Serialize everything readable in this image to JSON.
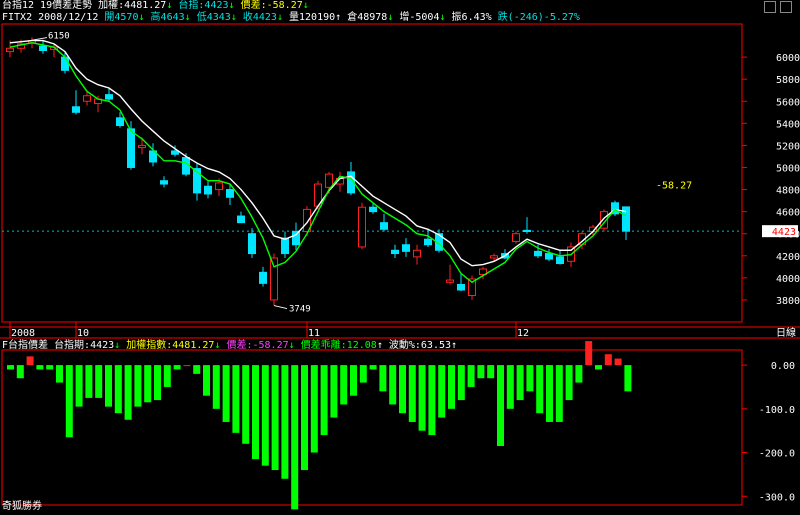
{
  "header": {
    "title": "台指12 19價差走勢",
    "index_label": "加權:",
    "index_value": "4481.27",
    "futures_label": "台指:",
    "futures_value": "4423",
    "spread_label": "價差:",
    "spread_value": "-58.27",
    "symbol": "FITX2",
    "date": "2008/12/12",
    "open": "開4570",
    "high": "高4643",
    "low": "低4343",
    "close": "收4423",
    "volume": "量120190",
    "oi": "倉48978",
    "oi_change": "增-5004",
    "amplitude": "振6.43%",
    "change": "跌(-246)-5.27%"
  },
  "lower_header": {
    "name": "F台指價差",
    "futures": "台指期:4423",
    "index": "加權指數:4481.27",
    "spread": "價差:-58.27",
    "spread_ratio": "價差乖離:12.08",
    "volatility": "波動%:63.53"
  },
  "footer": "奇狐勝券",
  "colors": {
    "up": "#ff2020",
    "down": "#00e5ff",
    "ma_white": "#ffffff",
    "ma_green": "#00ff00",
    "bar_pos": "#ff2020",
    "bar_neg": "#00ff00",
    "axis": "#ff0000"
  },
  "chart_data": [
    {
      "type": "candlestick",
      "ylim": [
        3600,
        6300
      ],
      "yticks": [
        3800,
        4000,
        4200,
        4400,
        4600,
        4800,
        5000,
        5200,
        5400,
        5600,
        5800,
        6000
      ],
      "x_labels": [
        {
          "i": 0,
          "text": "2008"
        },
        {
          "i": 6,
          "text": "10"
        },
        {
          "i": 27,
          "text": "11"
        },
        {
          "i": 46,
          "text": "12"
        }
      ],
      "last_price_tag": "4423",
      "spread_annotation": "-58.27",
      "high_annotation": "6150",
      "low_annotation": "3749",
      "x_axis_end_label": "日線",
      "candles": [
        [
          6050,
          6150,
          6000,
          6080
        ],
        [
          6080,
          6160,
          6040,
          6120
        ],
        [
          6130,
          6180,
          6080,
          6150
        ],
        [
          6100,
          6150,
          6030,
          6060
        ],
        [
          6070,
          6120,
          6000,
          6090
        ],
        [
          6000,
          6050,
          5850,
          5880
        ],
        [
          5550,
          5700,
          5480,
          5500
        ],
        [
          5600,
          5700,
          5560,
          5650
        ],
        [
          5580,
          5650,
          5500,
          5620
        ],
        [
          5660,
          5720,
          5600,
          5620
        ],
        [
          5450,
          5500,
          5360,
          5380
        ],
        [
          5350,
          5420,
          4980,
          5000
        ],
        [
          5180,
          5270,
          5120,
          5200
        ],
        [
          5150,
          5220,
          5010,
          5050
        ],
        [
          4880,
          4920,
          4820,
          4850
        ],
        [
          5150,
          5200,
          5100,
          5120
        ],
        [
          5090,
          5130,
          4920,
          4940
        ],
        [
          4990,
          5040,
          4700,
          4770
        ],
        [
          4830,
          4880,
          4720,
          4760
        ],
        [
          4800,
          4900,
          4740,
          4860
        ],
        [
          4800,
          4850,
          4660,
          4730
        ],
        [
          4560,
          4600,
          4500,
          4500
        ],
        [
          4400,
          4450,
          4180,
          4220
        ],
        [
          4050,
          4100,
          3920,
          3950
        ],
        [
          3800,
          4220,
          3749,
          4180
        ],
        [
          4360,
          4420,
          4180,
          4220
        ],
        [
          4420,
          4500,
          4250,
          4300
        ],
        [
          4420,
          4650,
          4380,
          4620
        ],
        [
          4650,
          4880,
          4620,
          4850
        ],
        [
          4820,
          4960,
          4760,
          4940
        ],
        [
          4850,
          4960,
          4780,
          4900
        ],
        [
          4960,
          5050,
          4750,
          4770
        ],
        [
          4280,
          4680,
          4260,
          4640
        ],
        [
          4640,
          4680,
          4580,
          4600
        ],
        [
          4500,
          4580,
          4420,
          4440
        ],
        [
          4250,
          4300,
          4180,
          4220
        ],
        [
          4300,
          4360,
          4190,
          4240
        ],
        [
          4190,
          4300,
          4120,
          4250
        ],
        [
          4350,
          4440,
          4280,
          4300
        ],
        [
          4400,
          4440,
          4230,
          4250
        ],
        [
          3960,
          4120,
          3940,
          3980
        ],
        [
          3940,
          4040,
          3880,
          3890
        ],
        [
          3840,
          4020,
          3800,
          3990
        ],
        [
          4030,
          4100,
          3990,
          4080
        ],
        [
          4180,
          4220,
          4150,
          4200
        ],
        [
          4220,
          4260,
          4170,
          4180
        ],
        [
          4330,
          4420,
          4310,
          4400
        ],
        [
          4430,
          4550,
          4400,
          4420
        ],
        [
          4240,
          4300,
          4180,
          4200
        ],
        [
          4220,
          4260,
          4150,
          4170
        ],
        [
          4190,
          4250,
          4120,
          4130
        ],
        [
          4150,
          4320,
          4100,
          4280
        ],
        [
          4300,
          4420,
          4260,
          4400
        ],
        [
          4420,
          4480,
          4380,
          4460
        ],
        [
          4450,
          4620,
          4420,
          4600
        ],
        [
          4680,
          4700,
          4560,
          4580
        ],
        [
          4643,
          4643,
          4343,
          4423
        ]
      ],
      "ma_white": [
        6130,
        6140,
        6150,
        6150,
        6120,
        6050,
        5900,
        5800,
        5750,
        5720,
        5650,
        5530,
        5420,
        5330,
        5240,
        5170,
        5100,
        5040,
        4990,
        4960,
        4900,
        4800,
        4680,
        4540,
        4380,
        4350,
        4390,
        4500,
        4650,
        4790,
        4900,
        4920,
        4830,
        4740,
        4680,
        4620,
        4560,
        4470,
        4440,
        4390,
        4320,
        4170,
        4110,
        4120,
        4150,
        4200,
        4280,
        4350,
        4310,
        4280,
        4250,
        4250,
        4330,
        4420,
        4540,
        4620,
        4600
      ],
      "ma_green": [
        6090,
        6110,
        6130,
        6110,
        6090,
        6000,
        5830,
        5690,
        5620,
        5600,
        5520,
        5330,
        5260,
        5160,
        5060,
        5060,
        5040,
        4960,
        4880,
        4880,
        4850,
        4720,
        4550,
        4360,
        4100,
        4140,
        4240,
        4400,
        4600,
        4800,
        4920,
        4900,
        4760,
        4680,
        4600,
        4540,
        4480,
        4400,
        4380,
        4310,
        4200,
        4040,
        3960,
        4020,
        4080,
        4140,
        4260,
        4330,
        4270,
        4230,
        4200,
        4210,
        4300,
        4380,
        4500,
        4620,
        4560
      ]
    },
    {
      "type": "bar",
      "ylim": [
        -320,
        30
      ],
      "yticks": [
        0,
        -100,
        -200,
        -300
      ],
      "values": [
        -10,
        -30,
        20,
        -10,
        -10,
        -40,
        -165,
        -95,
        -75,
        -75,
        -95,
        -110,
        -125,
        -95,
        -85,
        -80,
        -50,
        -10,
        0,
        -20,
        -70,
        -100,
        -130,
        -155,
        -180,
        -215,
        -230,
        -240,
        -260,
        -330,
        -240,
        -200,
        -160,
        -120,
        -90,
        -70,
        -40,
        -10,
        -60,
        -90,
        -110,
        -130,
        -150,
        -160,
        -120,
        -100,
        -80,
        -50,
        -30,
        -30,
        -185,
        -100,
        -80,
        -60,
        -110,
        -130,
        -130,
        -80,
        -40,
        55,
        -10,
        25,
        15,
        -60
      ]
    }
  ]
}
